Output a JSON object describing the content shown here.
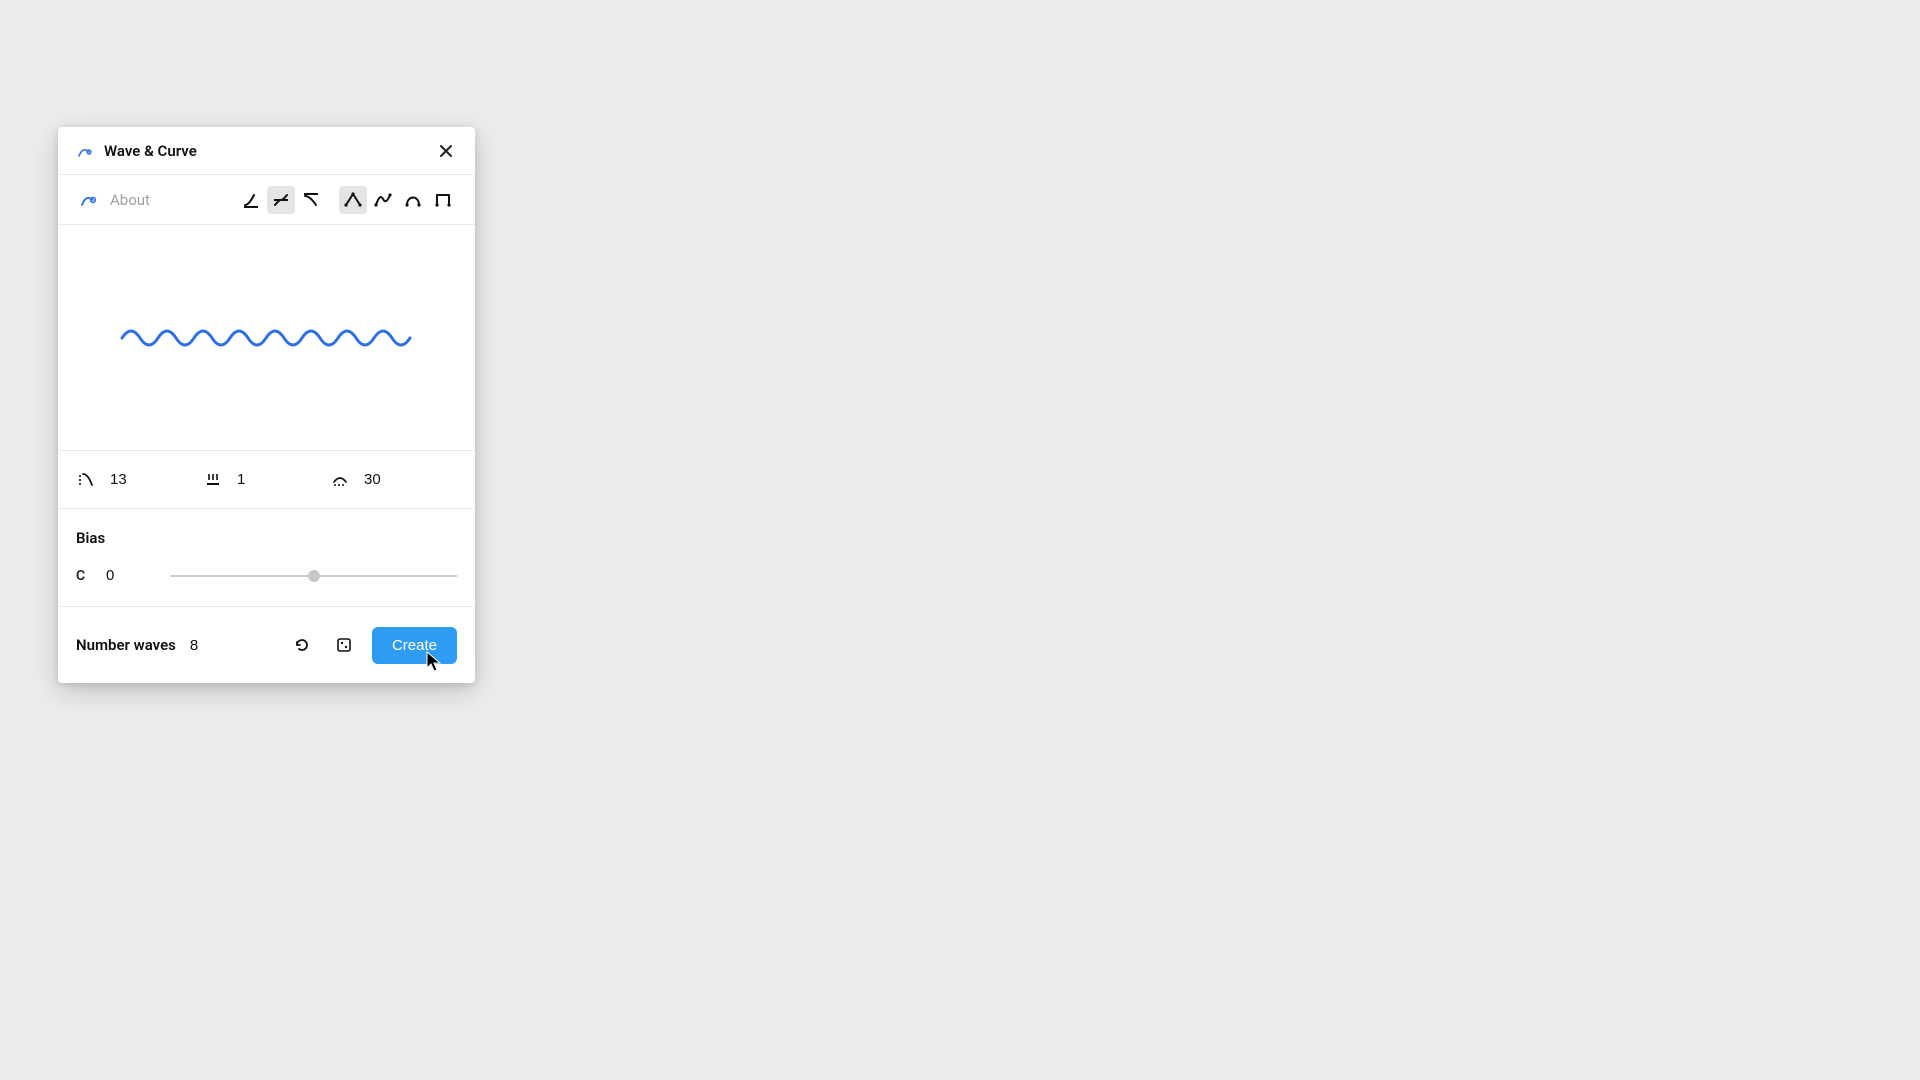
{
  "header": {
    "title": "Wave & Curve"
  },
  "toolbar": {
    "about_label": "About"
  },
  "params": {
    "curve_strength": "13",
    "stroke_width": "1",
    "arc_height": "30"
  },
  "bias": {
    "title": "Bias",
    "symbol": "C",
    "value": "0",
    "slider_min": -100,
    "slider_max": 100,
    "slider_value": 0
  },
  "footer": {
    "number_waves_label": "Number waves",
    "number_waves_value": "8",
    "create_label": "Create"
  },
  "colors": {
    "accent": "#2f6fe6",
    "button": "#2f9cf4"
  }
}
